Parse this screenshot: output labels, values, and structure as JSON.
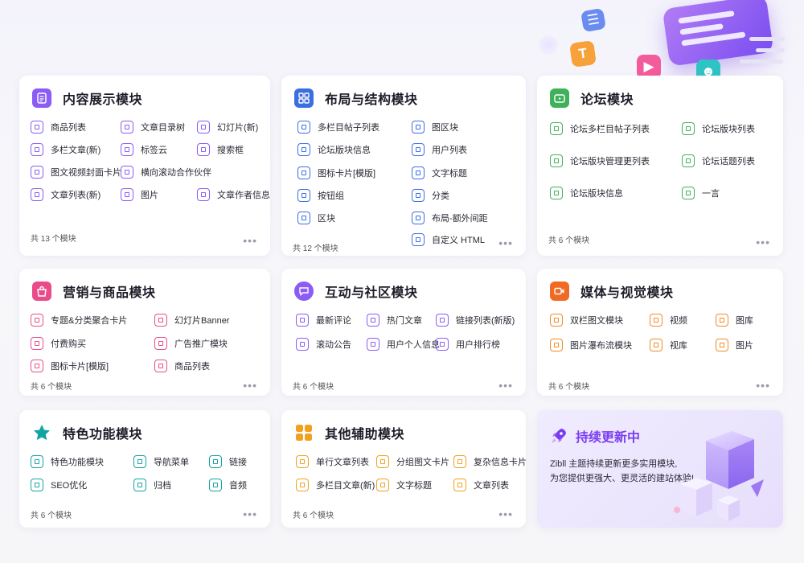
{
  "colors": {
    "purple": "#8b5cf6",
    "blue": "#3b6fe0",
    "green": "#3fb15b",
    "pink": "#ea4c89",
    "orange": "#f08a24",
    "teal": "#14a3a3",
    "amber": "#f2a01e"
  },
  "cards": {
    "content": {
      "title": "内容展示模块",
      "icon": "document-icon",
      "count": "共 13 个模块",
      "items": [
        "商品列表",
        "文章目录树",
        "幻灯片(新)",
        "多栏文章(新)",
        "标签云",
        "搜索框",
        "图文视频封面卡片",
        "横向滚动合作伙伴",
        "文章列表(新)",
        "图片",
        "文章作者信息"
      ]
    },
    "layout": {
      "title": "布局与结构模块",
      "icon": "grid-icon",
      "count": "共 12 个模块",
      "items": [
        "多栏目帖子列表",
        "图区块",
        "论坛版块信息",
        "用户列表",
        "图标卡片[模版]",
        "文字标题",
        "按钮组",
        "分类",
        "区块",
        "布局-额外间距",
        "自定义 HTML"
      ]
    },
    "forum": {
      "title": "论坛模块",
      "icon": "forum-icon",
      "count": "共 6 个模块",
      "items": [
        "论坛多栏目帖子列表",
        "论坛版块列表",
        "论坛版块管理更列表",
        "论坛话题列表",
        "论坛版块信息",
        "一言"
      ]
    },
    "marketing": {
      "title": "营销与商品模块",
      "icon": "shopping-bag-icon",
      "count": "共 6 个模块",
      "items": [
        "专题&分类聚合卡片",
        "幻灯片Banner",
        "付费购买",
        "广告推广模块",
        "图标卡片[模版]",
        "商品列表"
      ]
    },
    "community": {
      "title": "互动与社区模块",
      "icon": "chat-icon",
      "count": "共 6 个模块",
      "items": [
        "最新评论",
        "热门文章",
        "链接列表(新版)",
        "滚动公告",
        "用户个人信息",
        "用户排行榜"
      ]
    },
    "media": {
      "title": "媒体与视觉模块",
      "icon": "video-icon",
      "count": "共 6 个模块",
      "items": [
        "双栏图文模块",
        "视频",
        "图库",
        "图片瀑布流模块",
        "视库",
        "图片"
      ]
    },
    "feature": {
      "title": "特色功能模块",
      "icon": "star-icon",
      "count": "共 6 个模块",
      "items": [
        "特色功能模块",
        "导航菜单",
        "链接",
        "SEO优化",
        "归档",
        "音频"
      ]
    },
    "other": {
      "title": "其他辅助模块",
      "icon": "apps-icon",
      "count": "共 6 个模块",
      "items": [
        "单行文章列表",
        "分组图文卡片",
        "复杂信息卡片",
        "多栏目文章(新)",
        "文字标题",
        "文章列表"
      ]
    }
  },
  "promo": {
    "title": "持续更新中",
    "line1": "Zibll 主题持续更新更多实用模块,",
    "line2": "为您提供更强大、更灵活的建站体验!"
  },
  "more_label": "•••"
}
